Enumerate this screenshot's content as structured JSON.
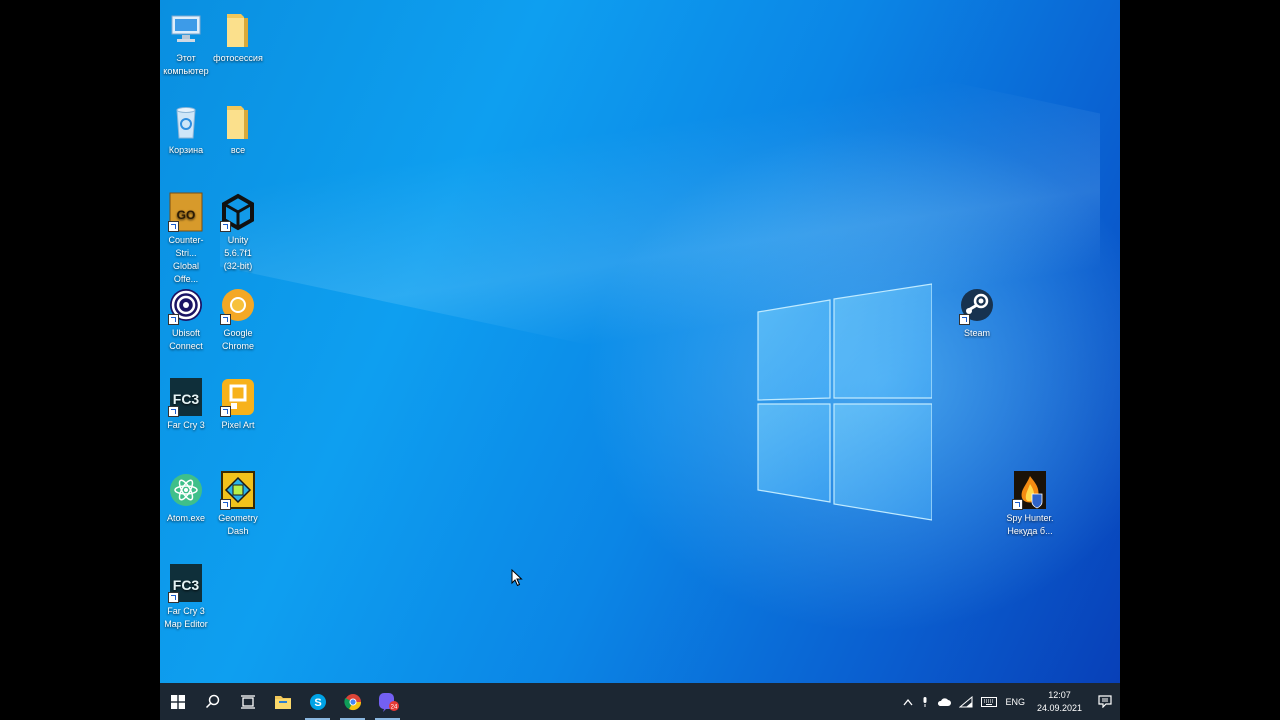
{
  "desktop": {
    "icons": [
      {
        "label": "Этот\nкомпьютер",
        "icon": "computer-icon"
      },
      {
        "label": "фотосессия",
        "icon": "folder-icon"
      },
      {
        "label": "Корзина",
        "icon": "recycle-bin-icon"
      },
      {
        "label": "все",
        "icon": "folder-icon"
      },
      {
        "label": "Counter-Stri...\nGlobal Offe...",
        "icon": "csgo-icon"
      },
      {
        "label": "Unity 5.6.7f1\n(32-bit)",
        "icon": "unity-icon"
      },
      {
        "label": "Ubisoft\nConnect",
        "icon": "ubisoft-icon"
      },
      {
        "label": "Google\nChrome",
        "icon": "chrome-icon"
      },
      {
        "label": "Far Cry 3",
        "icon": "farcry3-icon"
      },
      {
        "label": "Pixel Art",
        "icon": "pixel-art-icon"
      },
      {
        "label": "Atom.exe",
        "icon": "atom-icon"
      },
      {
        "label": "Geometry\nDash",
        "icon": "geometry-dash-icon"
      },
      {
        "label": "Far Cry 3\nMap Editor",
        "icon": "farcry3-editor-icon"
      },
      {
        "label": "Steam",
        "icon": "steam-icon"
      },
      {
        "label": "Spy Hunter.\nНекуда б...",
        "icon": "spy-hunter-icon"
      }
    ]
  },
  "taskbar": {
    "apps": [
      {
        "name": "start-button",
        "icon": "windows-icon"
      },
      {
        "name": "search-button",
        "icon": "search-icon"
      },
      {
        "name": "task-view-button",
        "icon": "task-view-icon"
      },
      {
        "name": "file-explorer",
        "icon": "folder-icon"
      },
      {
        "name": "skype",
        "icon": "skype-icon"
      },
      {
        "name": "chrome",
        "icon": "chrome-icon"
      },
      {
        "name": "viber",
        "icon": "viber-icon",
        "badge": "24"
      }
    ],
    "tray": {
      "language": "ENG",
      "time": "12:07",
      "date": "24.09.2021"
    }
  },
  "colors": {
    "taskbar": "#1c2733",
    "wallpaper_blue": "#0a8fe0",
    "accent": "#8ab7e0"
  }
}
